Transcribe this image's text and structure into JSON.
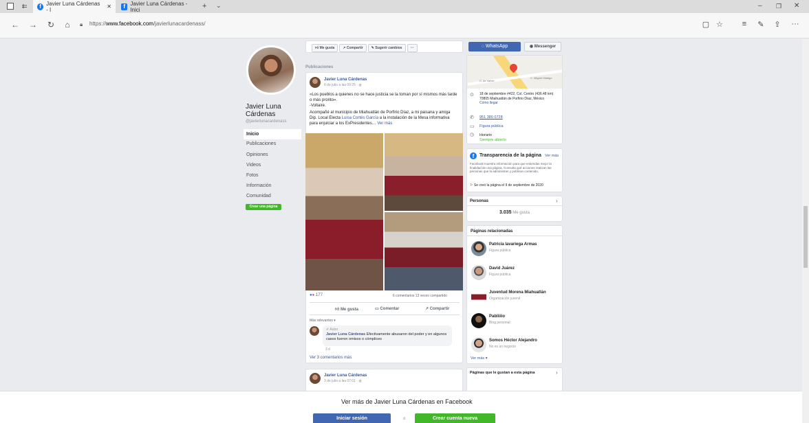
{
  "browser": {
    "tabs": [
      {
        "title": "Javier Luna Cárdenas - I"
      },
      {
        "title": "Javier Luna Cárdenas - Inici"
      }
    ],
    "url_prefix": "https://",
    "url_domain": "www.facebook.com",
    "url_path": "/javierlunacardenass/"
  },
  "profile": {
    "name": "Javier Luna Cárdenas",
    "handle": "@javierlunacardenass",
    "nav": [
      "Inicio",
      "Publicaciones",
      "Opiniones",
      "Videos",
      "Fotos",
      "Información",
      "Comunidad"
    ],
    "create_page": "Crear una página"
  },
  "actions": {
    "like": "Me gusta",
    "share": "Compartir",
    "suggest": "Sugerir cambios",
    "more": "···",
    "whatsapp": "WhatsApp",
    "messenger": "Messenger"
  },
  "posts_header": "Publicaciones",
  "post1": {
    "author": "Javier Luna Cárdenas",
    "time": "6 de julio a las 09:25 · ",
    "line1": "«Los pueblos a quienes no se hace justicia se la toman por sí mismos más tarde o más pronto».",
    "line2": "-Voltaire.",
    "text_a": "Acompañé al municipio de Miahuatlán de Porfirio Díaz, a mi paisana y amiga Dip. Local Electa ",
    "mention": "Luisa Cortés García",
    "text_b": " a la instalación de la Mesa informativa para enjuiciar a los ExPresidentes… ",
    "ver_mas": "Ver más",
    "reactions": "177",
    "comments_shares": "6 comentarios  13 veces compartido",
    "like": "Me gusta",
    "comment": "Comentar",
    "share": "Compartir",
    "relevant": "Más relevantes ▾",
    "comment_role": "✐ Autor",
    "comment_author": "Javier Luna Cárdenas",
    "comment_text": " Efectivamente abusaron del poder y en algunos casos fueron omisos o cómplices",
    "comment_time": "3 d",
    "more_comments": "Ver 3 comentarios más"
  },
  "post2": {
    "author": "Javier Luna Cárdenas",
    "time": "3 de julio a las 07:01 · "
  },
  "info": {
    "map_street1": "C. de Valver",
    "map_street2": "C. Miguel Hidalgo",
    "address": "18 de septiembre #422, Col. Centro (436.48 km)",
    "city": "70805 Miahuatlán de Porfirio Díaz, México",
    "directions": "Cómo llegar",
    "phone": "951 380 0728",
    "category": "Figura pública",
    "hours": "Horario",
    "open": "Siempre abierto"
  },
  "transparency": {
    "title": "Transparencia de la página",
    "see_all": "Ver más",
    "text": "Facebook muestra información para que entiendas mejor la finalidad de una página. Consulta qué acciones realizan las personas que la administran y publican contenido.",
    "created": "Se creó la página el 9 de septiembre de 2020"
  },
  "people": {
    "title": "Personas",
    "likes_num": "3.035",
    "likes_label": " Me gusta"
  },
  "related": {
    "title": "Páginas relacionadas",
    "more": "Ver más ▾",
    "items": [
      {
        "name": "Patricia lavariega Armas",
        "cat": "Figura pública"
      },
      {
        "name": "David Juárez",
        "cat": "Figura pública"
      },
      {
        "name": "Juventud Morena Miahuatlán",
        "cat": "Organización juvenil"
      },
      {
        "name": "Pabliiiio",
        "cat": "Blog personal"
      },
      {
        "name": "Somos Héctor Alejandro",
        "cat": "No es un negocio"
      }
    ]
  },
  "liked": {
    "title": "Páginas que le gustan a esta página"
  },
  "bottom": {
    "title": "Ver más de Javier Luna Cárdenas en Facebook",
    "login": "Iniciar sesión",
    "or": "o",
    "signup": "Crear cuenta nueva"
  }
}
